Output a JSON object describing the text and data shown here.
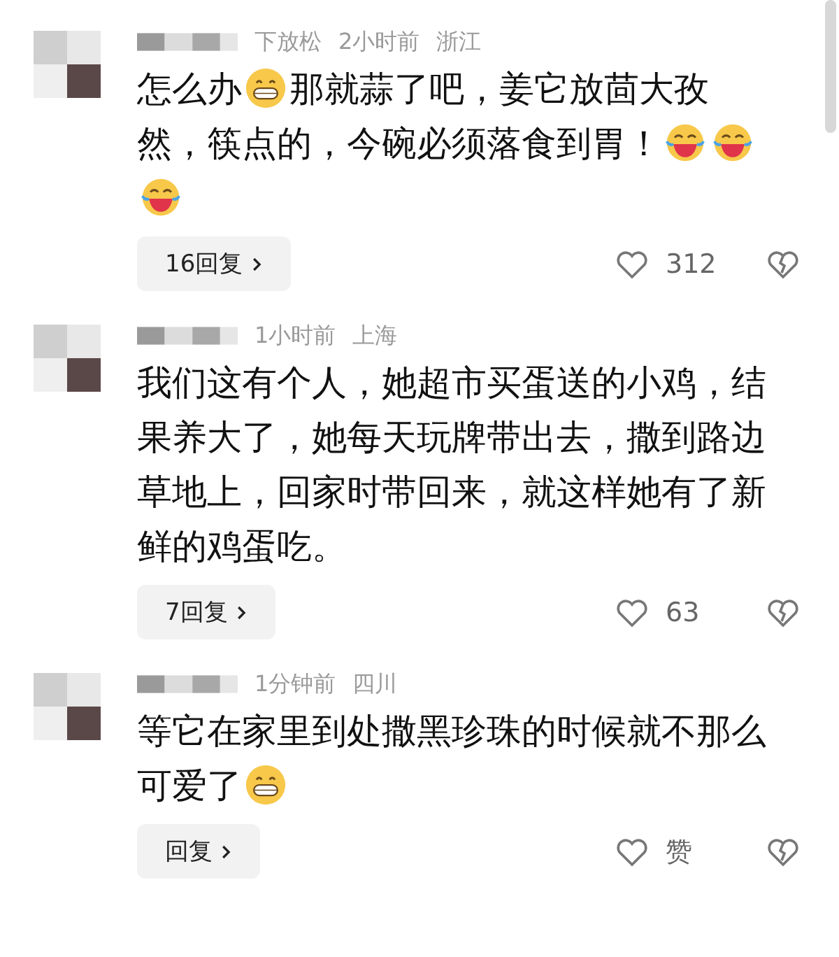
{
  "comments": [
    {
      "name_fragment": "下放松",
      "time": "2小时前",
      "location": "浙江",
      "body": [
        {
          "kind": "text",
          "text": "怎么办"
        },
        {
          "kind": "grin"
        },
        {
          "kind": "text",
          "text": "那就蒜了吧，姜它放茴大孜然，筷点的，今碗必须落食到胃！"
        },
        {
          "kind": "laugh"
        },
        {
          "kind": "laugh"
        },
        {
          "kind": "laugh"
        }
      ],
      "replies": "16回复",
      "likes": "312"
    },
    {
      "time": "1小时前",
      "location": "上海",
      "body": [
        {
          "kind": "text",
          "text": "我们这有个人，她超市买蛋送的小鸡，结果养大了，她每天玩牌带出去，撒到路边草地上，回家时带回来，就这样她有了新鲜的鸡蛋吃。"
        }
      ],
      "replies": "7回复",
      "likes": "63"
    },
    {
      "time": "1分钟前",
      "location": "四川",
      "body": [
        {
          "kind": "text",
          "text": "等它在家里到处撒黑珍珠的时候就不那么可爱了"
        },
        {
          "kind": "grin"
        }
      ],
      "replies": "回复",
      "likes": "赞"
    }
  ]
}
